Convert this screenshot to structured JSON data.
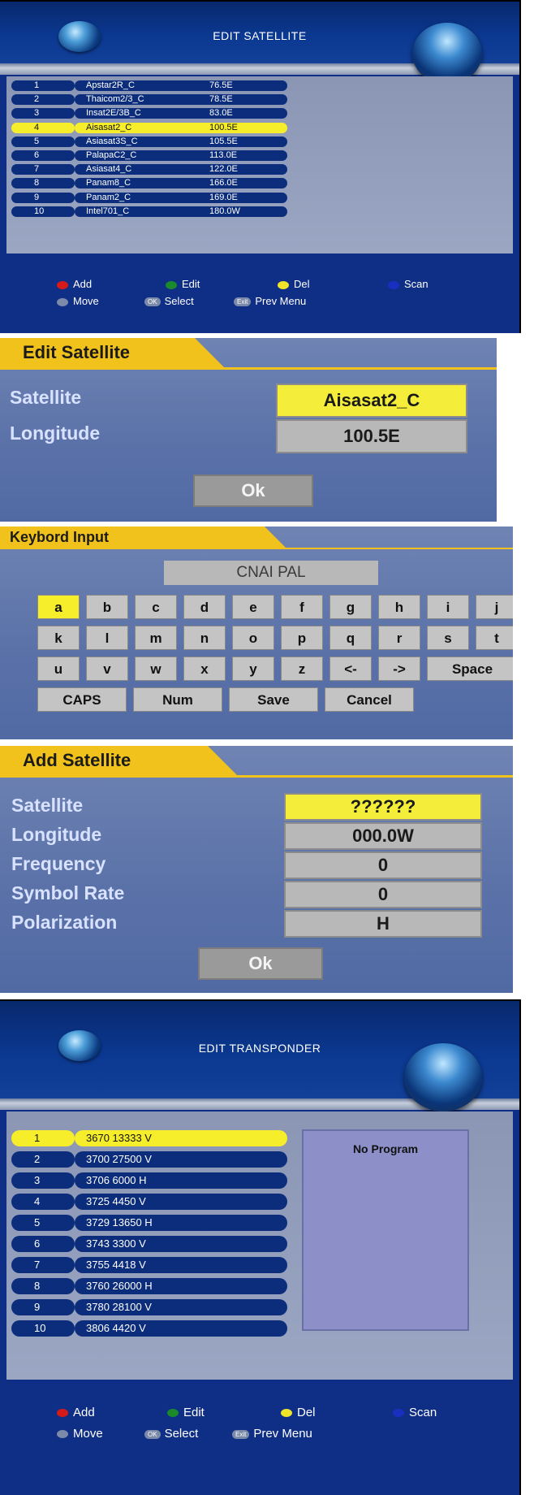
{
  "edit_satellite": {
    "title": "EDIT SATELLITE",
    "rows": [
      {
        "num": "1",
        "name": "Apstar2R_C",
        "lon": "76.5E"
      },
      {
        "num": "2",
        "name": "Thaicom2/3_C",
        "lon": "78.5E"
      },
      {
        "num": "3",
        "name": "Insat2E/3B_C",
        "lon": "83.0E"
      },
      {
        "num": "4",
        "name": "Aisasat2_C",
        "lon": "100.5E"
      },
      {
        "num": "5",
        "name": "Asiasat3S_C",
        "lon": "105.5E"
      },
      {
        "num": "6",
        "name": "PalapaC2_C",
        "lon": "113.0E"
      },
      {
        "num": "7",
        "name": "Asiasat4_C",
        "lon": "122.0E"
      },
      {
        "num": "8",
        "name": "Panam8_C",
        "lon": "166.0E"
      },
      {
        "num": "9",
        "name": "Panam2_C",
        "lon": "169.0E"
      },
      {
        "num": "10",
        "name": "Intel701_C",
        "lon": "180.0W"
      }
    ],
    "selected_index": 3,
    "legend": {
      "add": "Add",
      "edit": "Edit",
      "del": "Del",
      "scan": "Scan",
      "move": "Move",
      "select": "Select",
      "prev": "Prev Menu",
      "ok_key": "OK",
      "exit_key": "Exit"
    }
  },
  "edit_dialog": {
    "title": "Edit Satellite",
    "satellite_label": "Satellite",
    "satellite_value": "Aisasat2_C",
    "longitude_label": "Longitude",
    "longitude_value": "100.5E",
    "ok": "Ok"
  },
  "keyboard": {
    "title": "Keybord Input",
    "display": "CNAI PAL",
    "row1": [
      "a",
      "b",
      "c",
      "d",
      "e",
      "f",
      "g",
      "h",
      "i",
      "j"
    ],
    "row2": [
      "k",
      "l",
      "m",
      "n",
      "o",
      "p",
      "q",
      "r",
      "s",
      "t"
    ],
    "row3": [
      "u",
      "v",
      "w",
      "x",
      "y",
      "z",
      "<-",
      "->",
      "Space"
    ],
    "row4": [
      "CAPS",
      "Num",
      "Save",
      "Cancel"
    ]
  },
  "add_dialog": {
    "title": "Add Satellite",
    "rows": [
      {
        "label": "Satellite",
        "value": "??????"
      },
      {
        "label": "Longitude",
        "value": "000.0W"
      },
      {
        "label": "Frequency",
        "value": "0"
      },
      {
        "label": "Symbol Rate",
        "value": "0"
      },
      {
        "label": "Polarization",
        "value": "H"
      }
    ],
    "ok": "Ok"
  },
  "edit_transponder": {
    "title": "EDIT TRANSPONDER",
    "rows": [
      {
        "num": "1",
        "tp": "3670 13333 V"
      },
      {
        "num": "2",
        "tp": "3700 27500 V"
      },
      {
        "num": "3",
        "tp": "3706 6000 H"
      },
      {
        "num": "4",
        "tp": "3725 4450 V"
      },
      {
        "num": "5",
        "tp": "3729 13650 H"
      },
      {
        "num": "6",
        "tp": "3743 3300 V"
      },
      {
        "num": "7",
        "tp": "3755 4418 V"
      },
      {
        "num": "8",
        "tp": "3760 26000 H"
      },
      {
        "num": "9",
        "tp": "3780 28100 V"
      },
      {
        "num": "10",
        "tp": "3806 4420 V"
      }
    ],
    "selected_index": 0,
    "side_text": "No Program",
    "legend": {
      "add": "Add",
      "edit": "Edit",
      "del": "Del",
      "scan": "Scan",
      "move": "Move",
      "select": "Select",
      "prev": "Prev Menu",
      "ok_key": "OK",
      "exit_key": "Exit"
    }
  }
}
